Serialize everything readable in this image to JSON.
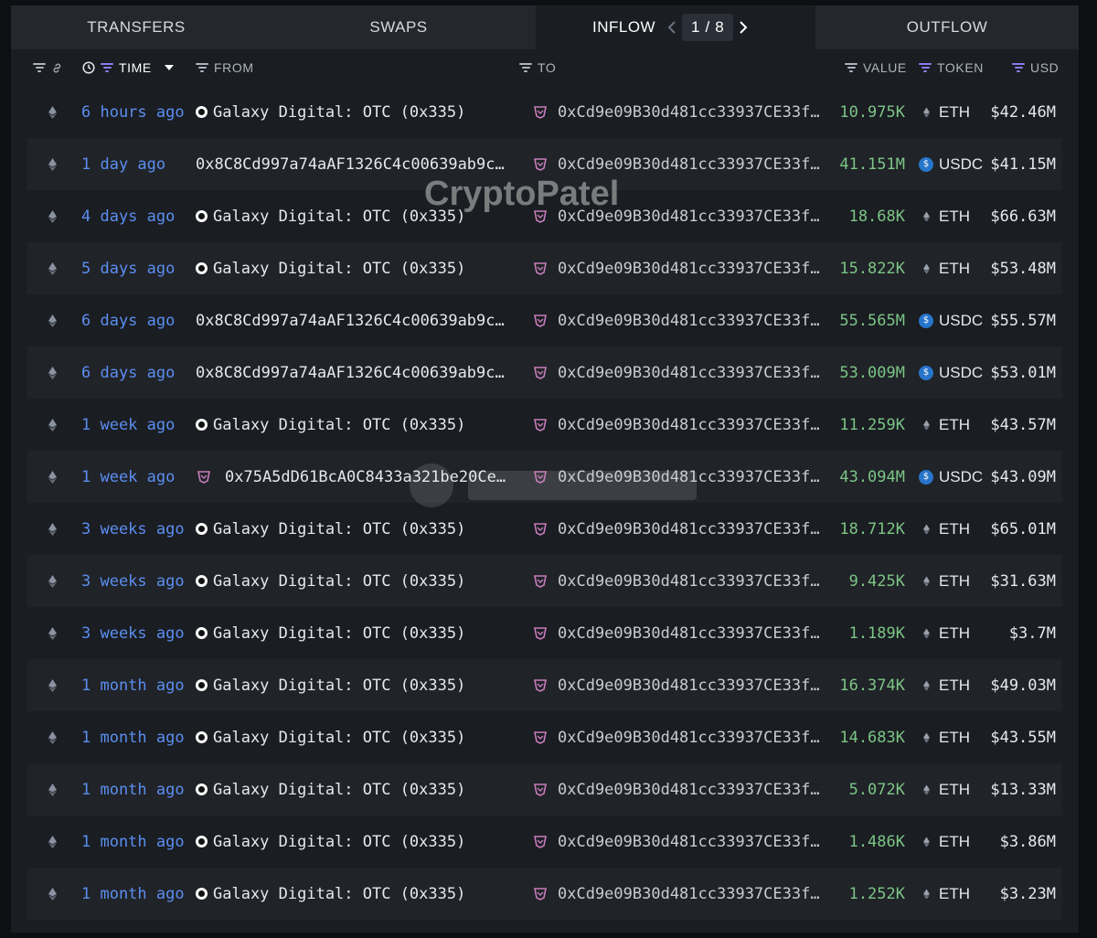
{
  "tabs": {
    "transfers": "TRANSFERS",
    "swaps": "SWAPS",
    "inflow": "INFLOW",
    "outflow": "OUTFLOW"
  },
  "pager": {
    "current": "1",
    "separator": "/",
    "total": "8"
  },
  "header": {
    "time": "TIME",
    "from": "FROM",
    "to": "TO",
    "value": "VALUE",
    "token": "TOKEN",
    "usd": "USD"
  },
  "watermark": "CryptoPatel",
  "colors": {
    "time_link": "#5b8ef0",
    "value": "#7cc586",
    "usdc": "#2775ca",
    "filter_active": "#8b7cf0",
    "entity_icon": "#c77dba"
  },
  "rows": [
    {
      "time": "6 hours ago",
      "from": "Galaxy Digital: OTC (0x335)",
      "from_icon": "galaxy-icon",
      "to": "0xCd9e09B30d481cc33937CE33fEB3…",
      "value": "10.975K",
      "token": "ETH",
      "usd": "$42.46M"
    },
    {
      "time": "1 day ago",
      "from": "0x8C8Cd997a74aAF1326C4c00639ab9c5…",
      "from_icon": "",
      "to": "0xCd9e09B30d481cc33937CE33fEB3…",
      "value": "41.151M",
      "token": "USDC",
      "usd": "$41.15M"
    },
    {
      "time": "4 days ago",
      "from": "Galaxy Digital: OTC (0x335)",
      "from_icon": "galaxy-icon",
      "to": "0xCd9e09B30d481cc33937CE33fEB3…",
      "value": "18.68K",
      "token": "ETH",
      "usd": "$66.63M"
    },
    {
      "time": "5 days ago",
      "from": "Galaxy Digital: OTC (0x335)",
      "from_icon": "galaxy-icon",
      "to": "0xCd9e09B30d481cc33937CE33fEB3…",
      "value": "15.822K",
      "token": "ETH",
      "usd": "$53.48M"
    },
    {
      "time": "6 days ago",
      "from": "0x8C8Cd997a74aAF1326C4c00639ab9c5…",
      "from_icon": "",
      "to": "0xCd9e09B30d481cc33937CE33fEB3…",
      "value": "55.565M",
      "token": "USDC",
      "usd": "$55.57M"
    },
    {
      "time": "6 days ago",
      "from": "0x8C8Cd997a74aAF1326C4c00639ab9c5…",
      "from_icon": "",
      "to": "0xCd9e09B30d481cc33937CE33fEB3…",
      "value": "53.009M",
      "token": "USDC",
      "usd": "$53.01M"
    },
    {
      "time": "1 week ago",
      "from": "Galaxy Digital: OTC (0x335)",
      "from_icon": "galaxy-icon",
      "to": "0xCd9e09B30d481cc33937CE33fEB3…",
      "value": "11.259K",
      "token": "ETH",
      "usd": "$43.57M"
    },
    {
      "time": "1 week ago",
      "from": "0x75A5dD61BcA0C8433a321be20Cea…",
      "from_icon": "entity-icon",
      "to": "0xCd9e09B30d481cc33937CE33fEB3…",
      "value": "43.094M",
      "token": "USDC",
      "usd": "$43.09M"
    },
    {
      "time": "3 weeks ago",
      "from": "Galaxy Digital: OTC (0x335)",
      "from_icon": "galaxy-icon",
      "to": "0xCd9e09B30d481cc33937CE33fEB3…",
      "value": "18.712K",
      "token": "ETH",
      "usd": "$65.01M"
    },
    {
      "time": "3 weeks ago",
      "from": "Galaxy Digital: OTC (0x335)",
      "from_icon": "galaxy-icon",
      "to": "0xCd9e09B30d481cc33937CE33fEB3…",
      "value": "9.425K",
      "token": "ETH",
      "usd": "$31.63M"
    },
    {
      "time": "3 weeks ago",
      "from": "Galaxy Digital: OTC (0x335)",
      "from_icon": "galaxy-icon",
      "to": "0xCd9e09B30d481cc33937CE33fEB3…",
      "value": "1.189K",
      "token": "ETH",
      "usd": "$3.7M"
    },
    {
      "time": "1 month ago",
      "from": "Galaxy Digital: OTC (0x335)",
      "from_icon": "galaxy-icon",
      "to": "0xCd9e09B30d481cc33937CE33fEB3…",
      "value": "16.374K",
      "token": "ETH",
      "usd": "$49.03M"
    },
    {
      "time": "1 month ago",
      "from": "Galaxy Digital: OTC (0x335)",
      "from_icon": "galaxy-icon",
      "to": "0xCd9e09B30d481cc33937CE33fEB3…",
      "value": "14.683K",
      "token": "ETH",
      "usd": "$43.55M"
    },
    {
      "time": "1 month ago",
      "from": "Galaxy Digital: OTC (0x335)",
      "from_icon": "galaxy-icon",
      "to": "0xCd9e09B30d481cc33937CE33fEB3…",
      "value": "5.072K",
      "token": "ETH",
      "usd": "$13.33M"
    },
    {
      "time": "1 month ago",
      "from": "Galaxy Digital: OTC (0x335)",
      "from_icon": "galaxy-icon",
      "to": "0xCd9e09B30d481cc33937CE33fEB3…",
      "value": "1.486K",
      "token": "ETH",
      "usd": "$3.86M"
    },
    {
      "time": "1 month ago",
      "from": "Galaxy Digital: OTC (0x335)",
      "from_icon": "galaxy-icon",
      "to": "0xCd9e09B30d481cc33937CE33fEB3…",
      "value": "1.252K",
      "token": "ETH",
      "usd": "$3.23M"
    }
  ]
}
